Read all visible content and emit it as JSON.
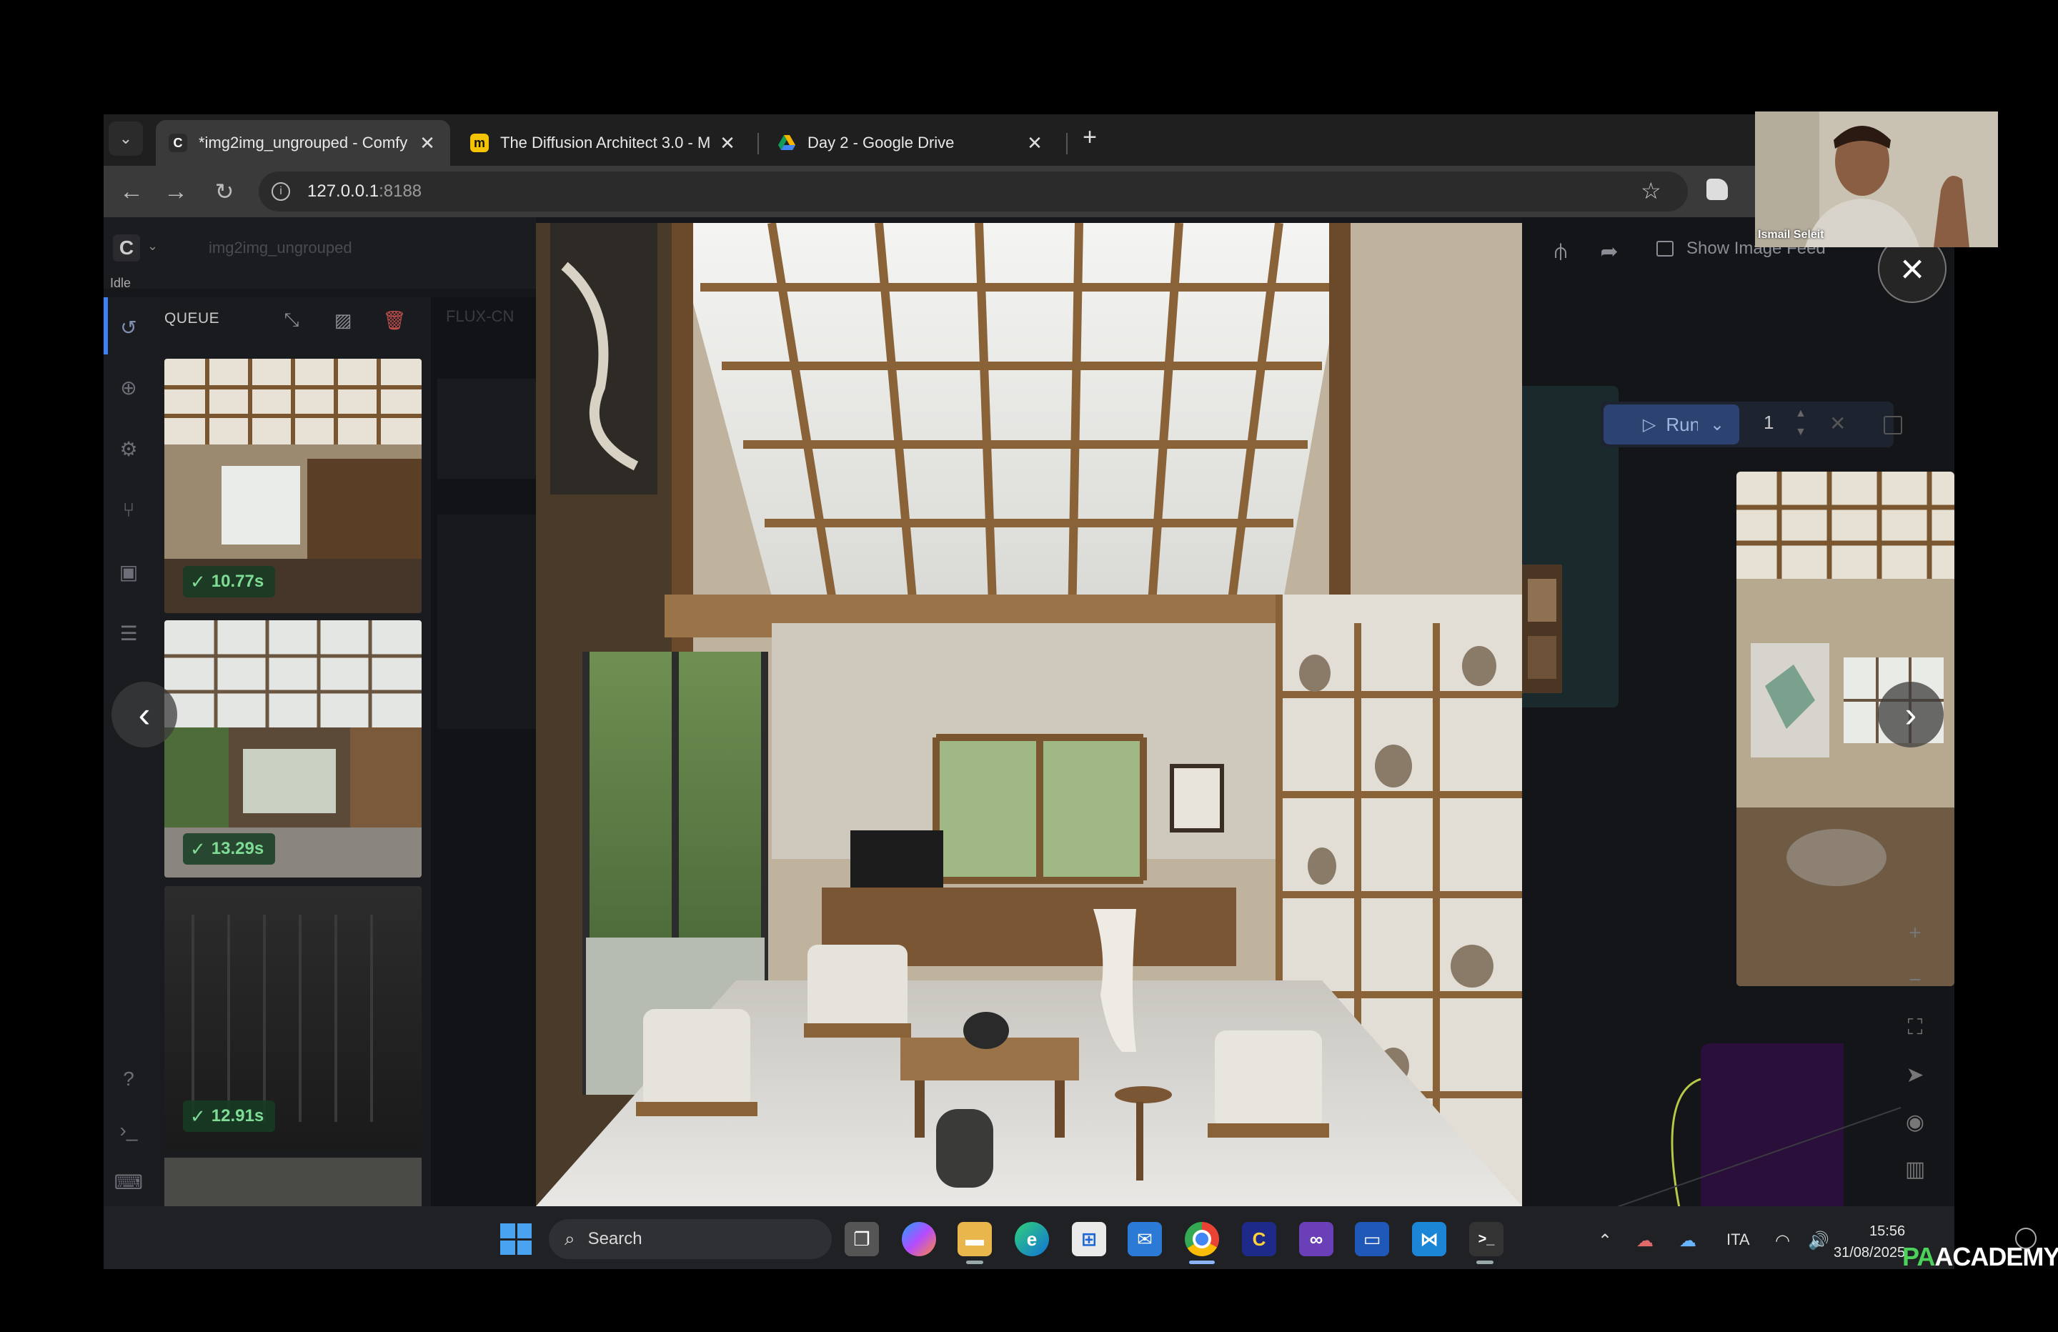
{
  "browser": {
    "tabs": [
      {
        "title": "*img2img_ungrouped - Comfy",
        "favicon": "comfy-icon",
        "active": true
      },
      {
        "title": "The Diffusion Architect 3.0 - M",
        "favicon": "miro-icon",
        "active": false
      },
      {
        "title": "Day 2 - Google Drive",
        "favicon": "drive-icon",
        "active": false
      }
    ],
    "new_tab_label": "+",
    "url_host": "127.0.0.1",
    "url_port": ":8188"
  },
  "app": {
    "workflow_name": "img2img_ungrouped",
    "status": "Idle",
    "queue": {
      "title": "QUEUE",
      "items": [
        {
          "time": "10.77s"
        },
        {
          "time": "13.29s"
        },
        {
          "time": "12.91s"
        }
      ]
    },
    "canvas_node_label": "FLUX-CN",
    "show_image_feed": "Show Image Feed",
    "run": {
      "label": "Run",
      "count": "1"
    }
  },
  "taskbar": {
    "search_placeholder": "Search",
    "language": "ITA",
    "time": "15:56",
    "date": "31/08/2025"
  },
  "webcam": {
    "name": "Ismail Seleit"
  },
  "watermark": {
    "prefix": "PA",
    "suffix": "ACADEMY"
  },
  "colors": {
    "accent": "#3b82f6",
    "success": "#7fdc95",
    "run_button": "#2c4270"
  }
}
